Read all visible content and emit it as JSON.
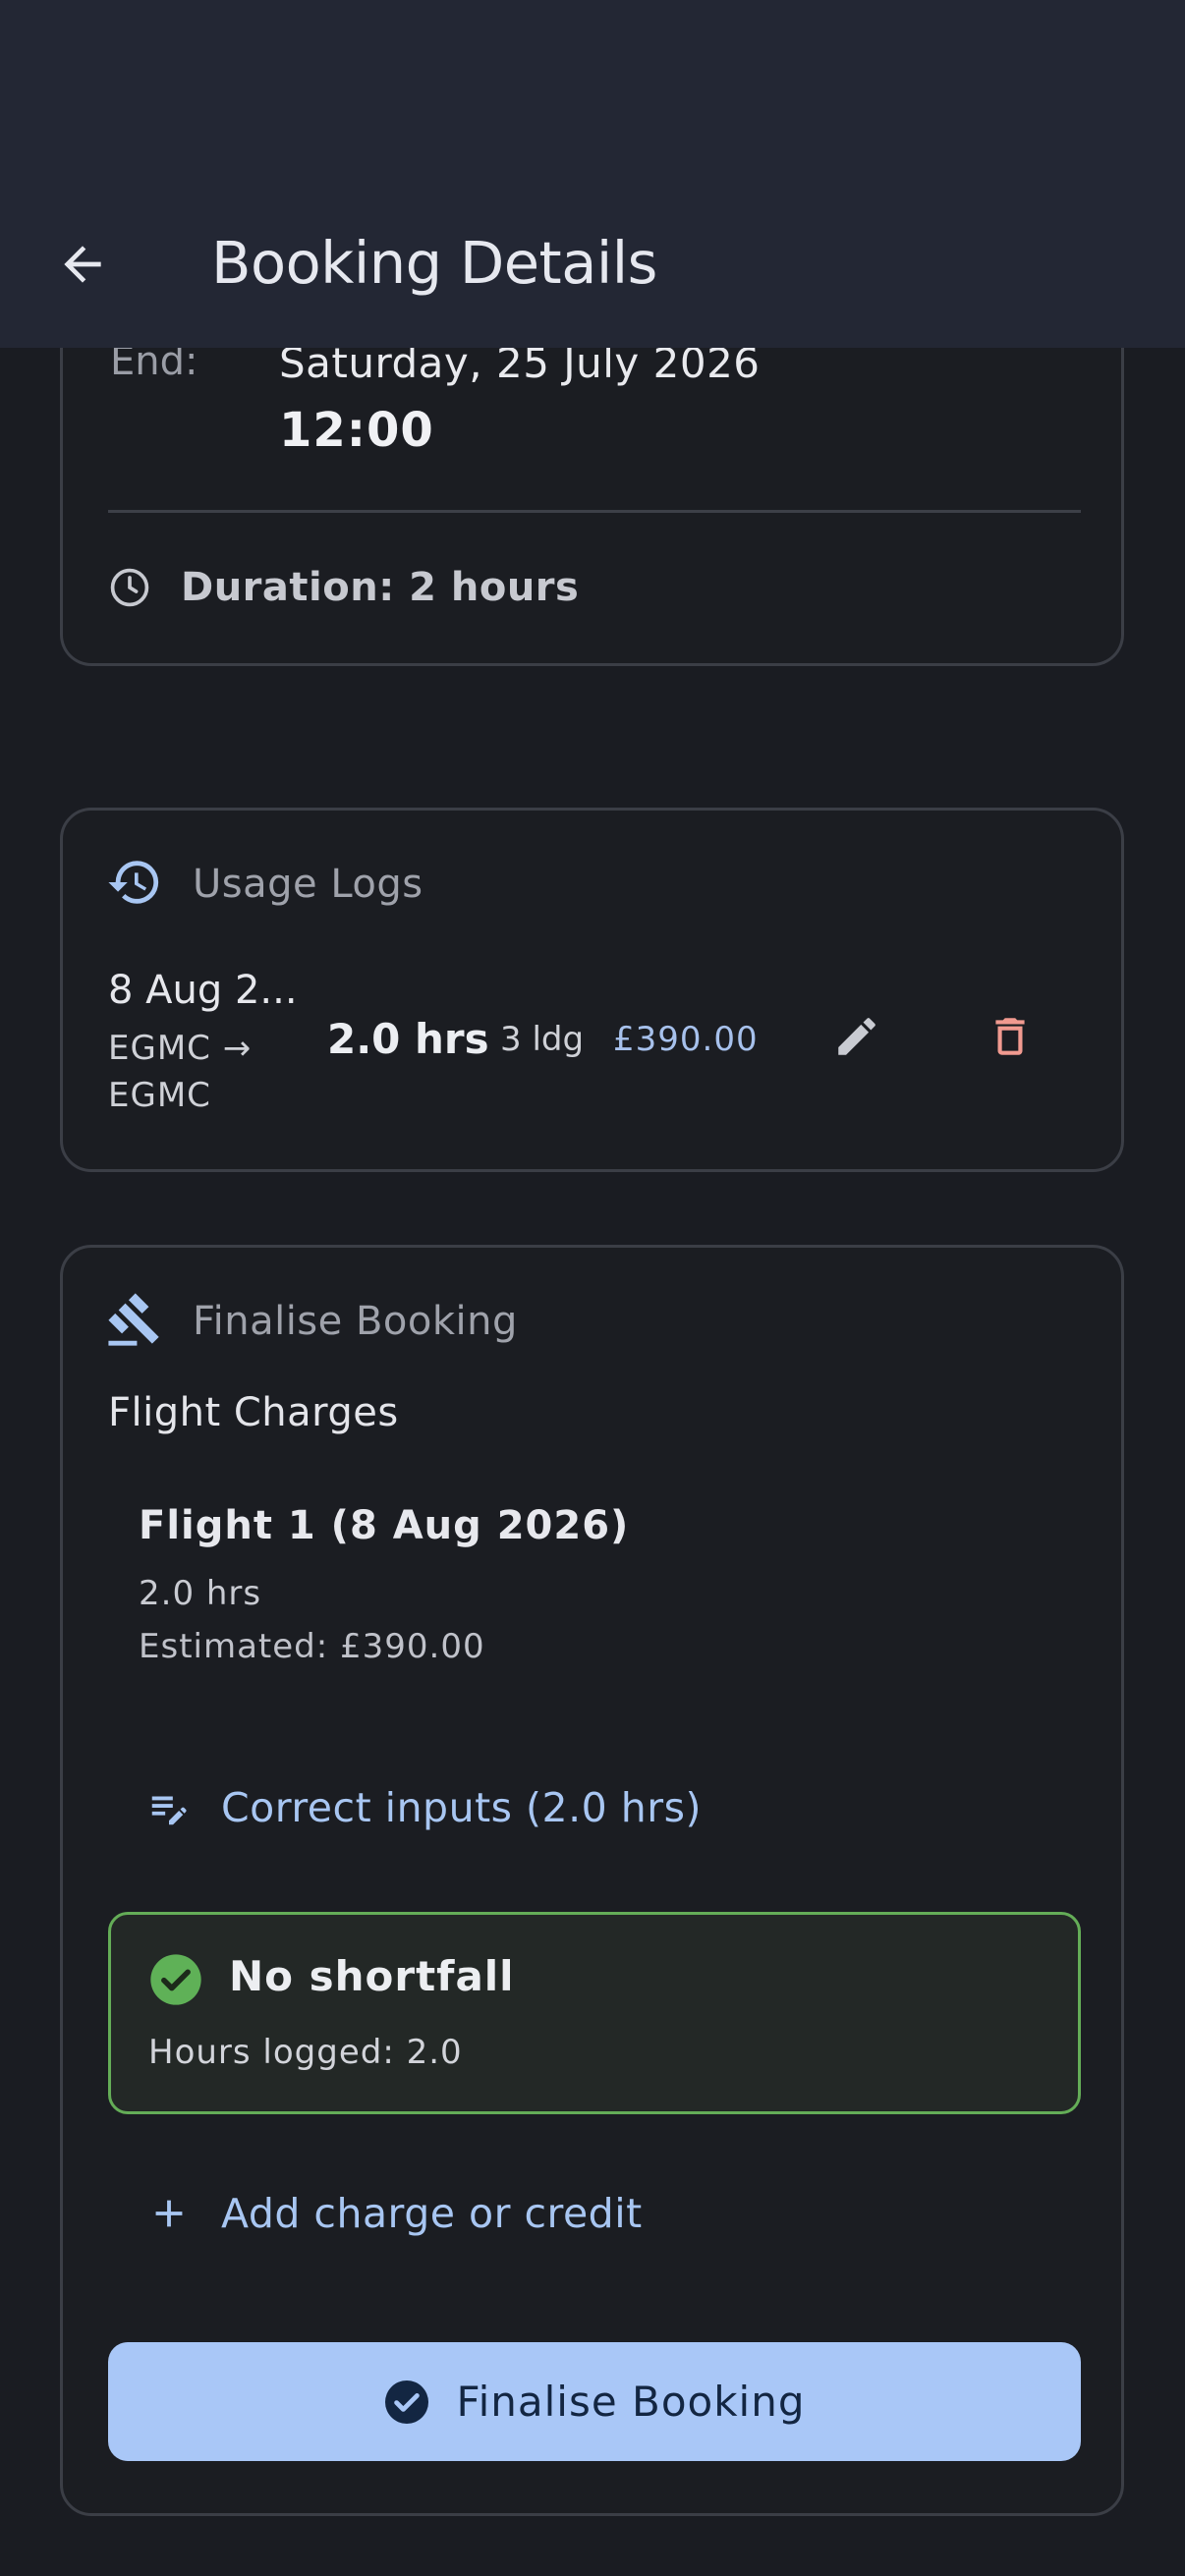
{
  "app_bar": {
    "title": "Booking Details",
    "back_icon": "arrow-back-icon"
  },
  "schedule": {
    "end_label": "End:",
    "end_date": "Saturday, 25 July 2026",
    "end_time": "12:00",
    "duration": "Duration: 2 hours",
    "duration_icon": "clock-icon"
  },
  "usage_logs": {
    "title": "Usage Logs",
    "icon": "history-icon",
    "entries": [
      {
        "date": "8 Aug 2...",
        "route_line1": "EGMC →",
        "route_line2": "EGMC",
        "hours": "2.0 hrs",
        "landings": "3 ldg",
        "amount": "£390.00"
      }
    ]
  },
  "finalise": {
    "title": "Finalise Booking",
    "icon": "gavel-icon",
    "flight_charges_label": "Flight Charges",
    "flights": [
      {
        "title": "Flight 1 (8 Aug 2026)",
        "hours": "2.0 hrs",
        "estimated": "Estimated: £390.00"
      }
    ],
    "correct_inputs_label": "Correct inputs (2.0 hrs)",
    "status": {
      "title": "No shortfall",
      "detail": "Hours logged: 2.0"
    },
    "add_charge_label": "Add charge or credit",
    "finalise_button_label": "Finalise Booking"
  },
  "colors": {
    "background": "#1a1c22",
    "app_bar": "#232734",
    "accent": "#a9c7f7",
    "success": "#64ad57",
    "danger": "#f19a90"
  }
}
